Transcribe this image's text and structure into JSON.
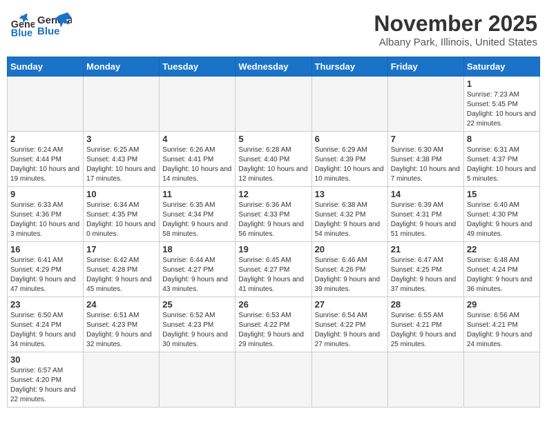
{
  "logo": {
    "text_general": "General",
    "text_blue": "Blue"
  },
  "header": {
    "month": "November 2025",
    "location": "Albany Park, Illinois, United States"
  },
  "weekdays": [
    "Sunday",
    "Monday",
    "Tuesday",
    "Wednesday",
    "Thursday",
    "Friday",
    "Saturday"
  ],
  "weeks": [
    [
      {
        "day": "",
        "info": ""
      },
      {
        "day": "",
        "info": ""
      },
      {
        "day": "",
        "info": ""
      },
      {
        "day": "",
        "info": ""
      },
      {
        "day": "",
        "info": ""
      },
      {
        "day": "",
        "info": ""
      },
      {
        "day": "1",
        "info": "Sunrise: 7:23 AM\nSunset: 5:45 PM\nDaylight: 10 hours and 22 minutes."
      }
    ],
    [
      {
        "day": "2",
        "info": "Sunrise: 6:24 AM\nSunset: 4:44 PM\nDaylight: 10 hours and 19 minutes."
      },
      {
        "day": "3",
        "info": "Sunrise: 6:25 AM\nSunset: 4:43 PM\nDaylight: 10 hours and 17 minutes."
      },
      {
        "day": "4",
        "info": "Sunrise: 6:26 AM\nSunset: 4:41 PM\nDaylight: 10 hours and 14 minutes."
      },
      {
        "day": "5",
        "info": "Sunrise: 6:28 AM\nSunset: 4:40 PM\nDaylight: 10 hours and 12 minutes."
      },
      {
        "day": "6",
        "info": "Sunrise: 6:29 AM\nSunset: 4:39 PM\nDaylight: 10 hours and 10 minutes."
      },
      {
        "day": "7",
        "info": "Sunrise: 6:30 AM\nSunset: 4:38 PM\nDaylight: 10 hours and 7 minutes."
      },
      {
        "day": "8",
        "info": "Sunrise: 6:31 AM\nSunset: 4:37 PM\nDaylight: 10 hours and 5 minutes."
      }
    ],
    [
      {
        "day": "9",
        "info": "Sunrise: 6:33 AM\nSunset: 4:36 PM\nDaylight: 10 hours and 3 minutes."
      },
      {
        "day": "10",
        "info": "Sunrise: 6:34 AM\nSunset: 4:35 PM\nDaylight: 10 hours and 0 minutes."
      },
      {
        "day": "11",
        "info": "Sunrise: 6:35 AM\nSunset: 4:34 PM\nDaylight: 9 hours and 58 minutes."
      },
      {
        "day": "12",
        "info": "Sunrise: 6:36 AM\nSunset: 4:33 PM\nDaylight: 9 hours and 56 minutes."
      },
      {
        "day": "13",
        "info": "Sunrise: 6:38 AM\nSunset: 4:32 PM\nDaylight: 9 hours and 54 minutes."
      },
      {
        "day": "14",
        "info": "Sunrise: 6:39 AM\nSunset: 4:31 PM\nDaylight: 9 hours and 51 minutes."
      },
      {
        "day": "15",
        "info": "Sunrise: 6:40 AM\nSunset: 4:30 PM\nDaylight: 9 hours and 49 minutes."
      }
    ],
    [
      {
        "day": "16",
        "info": "Sunrise: 6:41 AM\nSunset: 4:29 PM\nDaylight: 9 hours and 47 minutes."
      },
      {
        "day": "17",
        "info": "Sunrise: 6:42 AM\nSunset: 4:28 PM\nDaylight: 9 hours and 45 minutes."
      },
      {
        "day": "18",
        "info": "Sunrise: 6:44 AM\nSunset: 4:27 PM\nDaylight: 9 hours and 43 minutes."
      },
      {
        "day": "19",
        "info": "Sunrise: 6:45 AM\nSunset: 4:27 PM\nDaylight: 9 hours and 41 minutes."
      },
      {
        "day": "20",
        "info": "Sunrise: 6:46 AM\nSunset: 4:26 PM\nDaylight: 9 hours and 39 minutes."
      },
      {
        "day": "21",
        "info": "Sunrise: 6:47 AM\nSunset: 4:25 PM\nDaylight: 9 hours and 37 minutes."
      },
      {
        "day": "22",
        "info": "Sunrise: 6:48 AM\nSunset: 4:24 PM\nDaylight: 9 hours and 36 minutes."
      }
    ],
    [
      {
        "day": "23",
        "info": "Sunrise: 6:50 AM\nSunset: 4:24 PM\nDaylight: 9 hours and 34 minutes."
      },
      {
        "day": "24",
        "info": "Sunrise: 6:51 AM\nSunset: 4:23 PM\nDaylight: 9 hours and 32 minutes."
      },
      {
        "day": "25",
        "info": "Sunrise: 6:52 AM\nSunset: 4:23 PM\nDaylight: 9 hours and 30 minutes."
      },
      {
        "day": "26",
        "info": "Sunrise: 6:53 AM\nSunset: 4:22 PM\nDaylight: 9 hours and 29 minutes."
      },
      {
        "day": "27",
        "info": "Sunrise: 6:54 AM\nSunset: 4:22 PM\nDaylight: 9 hours and 27 minutes."
      },
      {
        "day": "28",
        "info": "Sunrise: 6:55 AM\nSunset: 4:21 PM\nDaylight: 9 hours and 25 minutes."
      },
      {
        "day": "29",
        "info": "Sunrise: 6:56 AM\nSunset: 4:21 PM\nDaylight: 9 hours and 24 minutes."
      }
    ],
    [
      {
        "day": "30",
        "info": "Sunrise: 6:57 AM\nSunset: 4:20 PM\nDaylight: 9 hours and 22 minutes."
      },
      {
        "day": "",
        "info": ""
      },
      {
        "day": "",
        "info": ""
      },
      {
        "day": "",
        "info": ""
      },
      {
        "day": "",
        "info": ""
      },
      {
        "day": "",
        "info": ""
      },
      {
        "day": "",
        "info": ""
      }
    ]
  ]
}
